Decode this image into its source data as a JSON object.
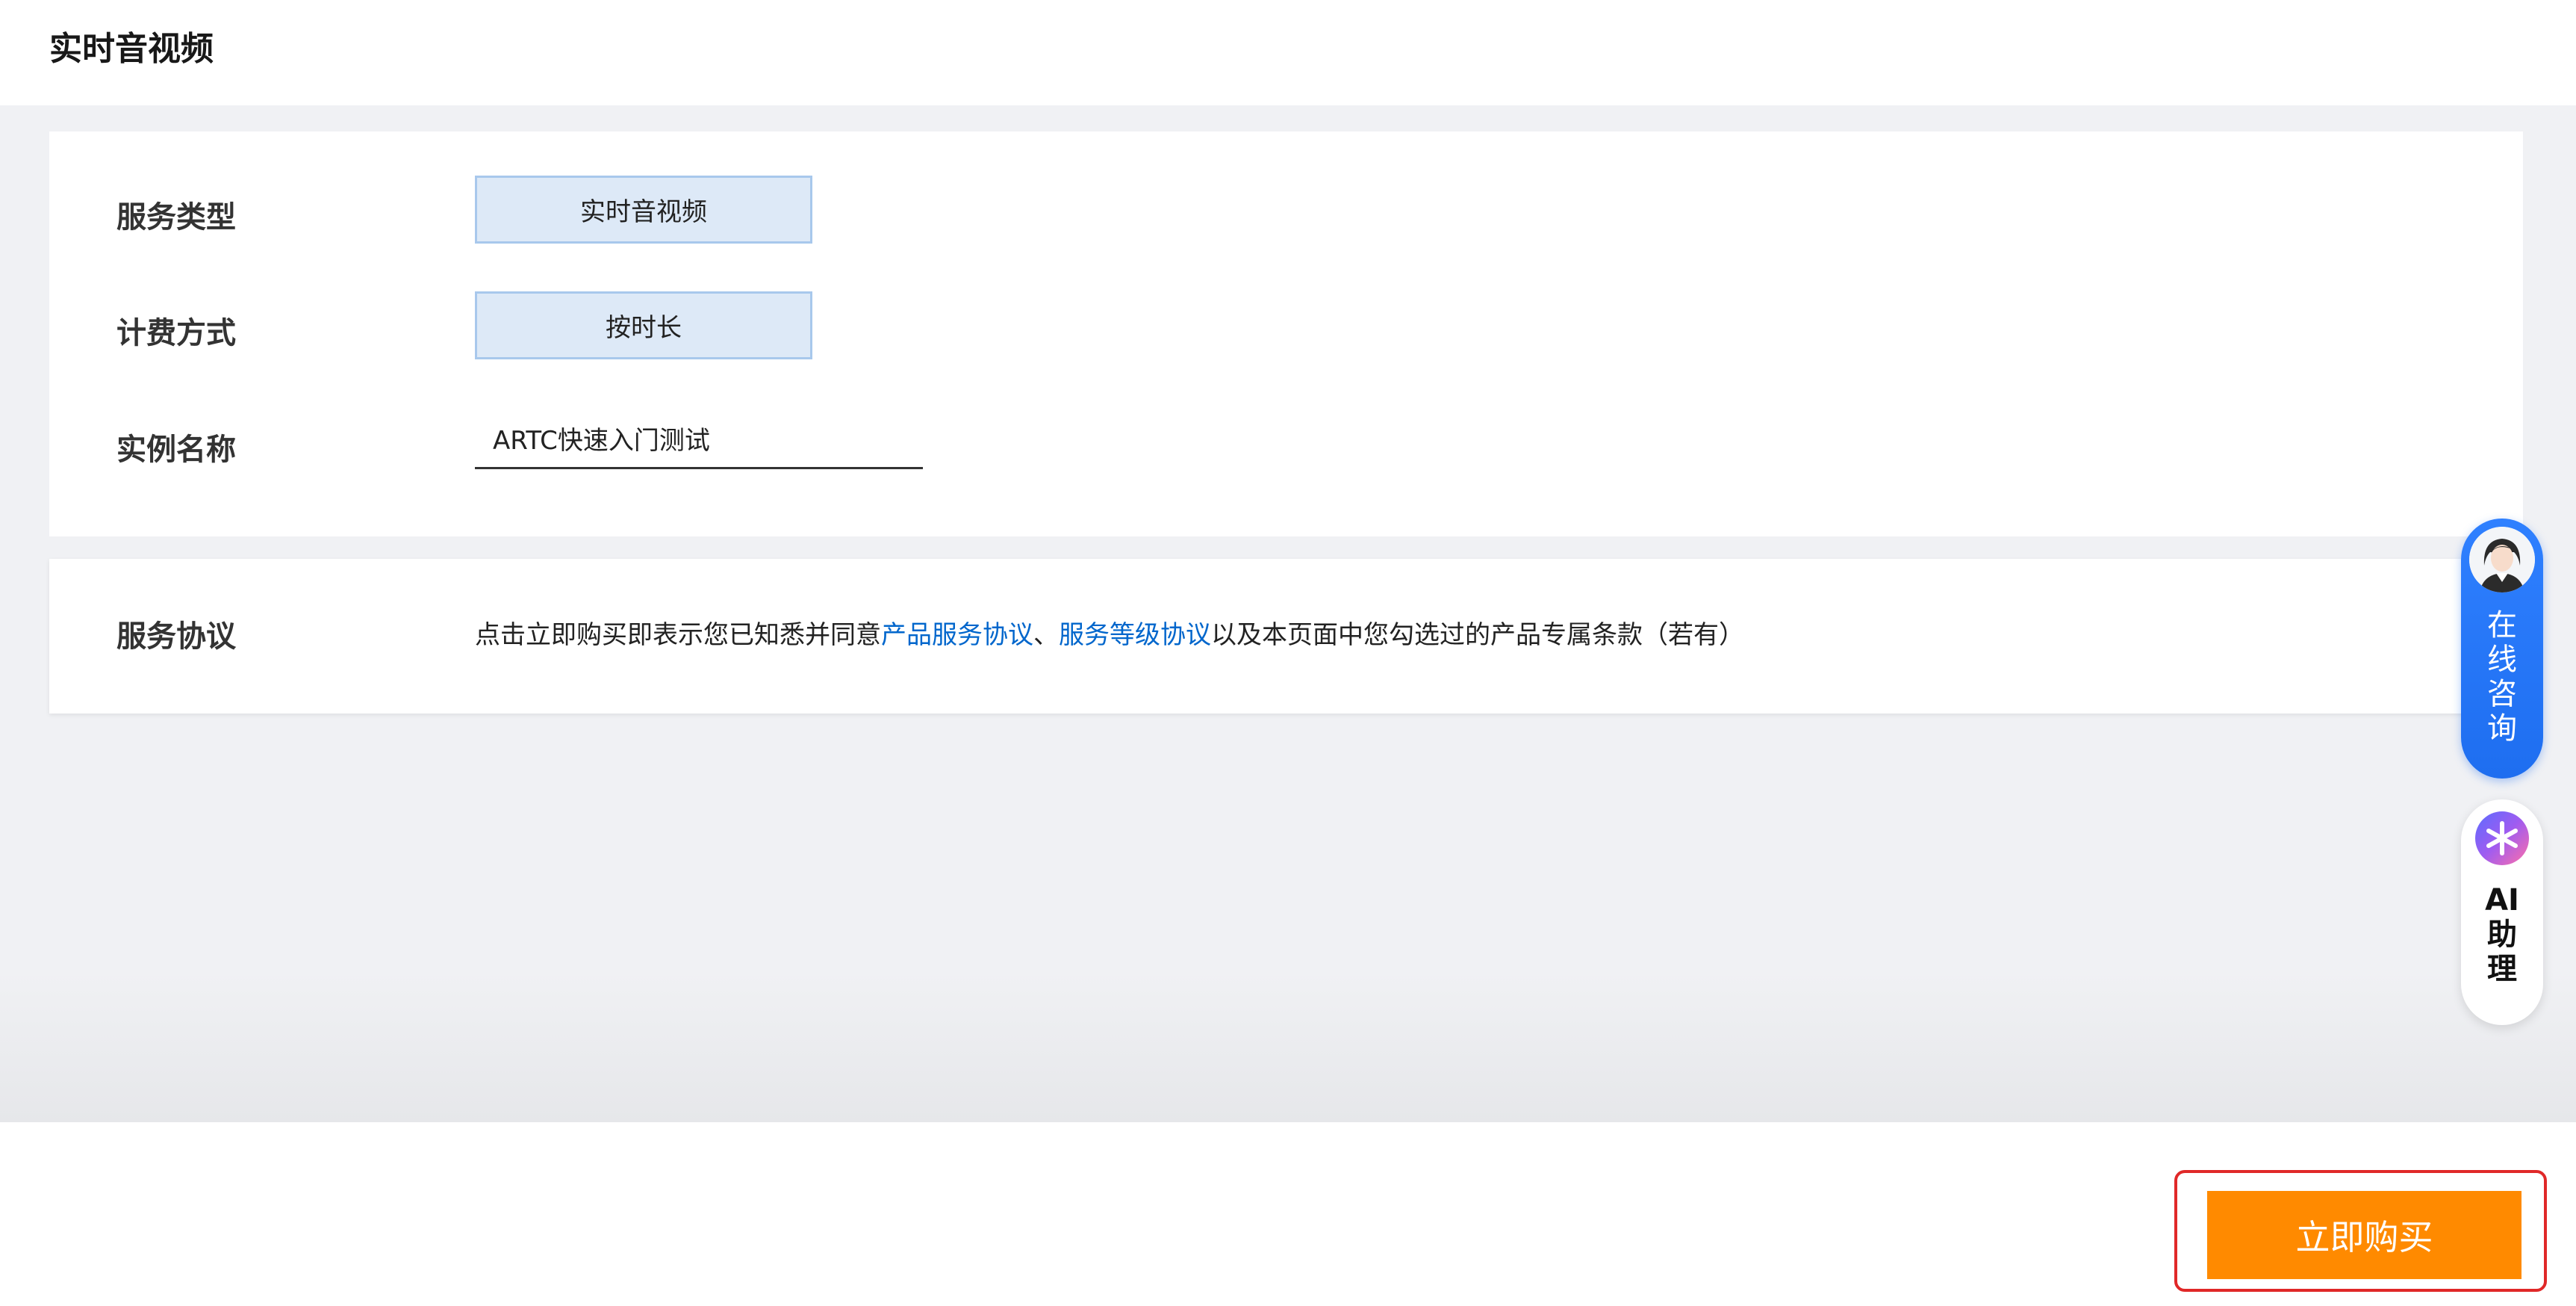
{
  "header": {
    "title": "实时音视频"
  },
  "config": {
    "service_type": {
      "label": "服务类型",
      "value": "实时音视频"
    },
    "billing": {
      "label": "计费方式",
      "value": "按时长"
    },
    "instance_name": {
      "label": "实例名称",
      "value": "ARTC快速入门测试"
    }
  },
  "agreement": {
    "label": "服务协议",
    "text_before": "点击立即购买即表示您已知悉并同意",
    "link1": "产品服务协议",
    "separator": "、",
    "link2": "服务等级协议",
    "text_after": "以及本页面中您勾选过的产品专属条款（若有）"
  },
  "footer": {
    "buy_label": "立即购买"
  },
  "floating": {
    "consult_line1": "在",
    "consult_line2": "线",
    "consult_line3": "咨",
    "consult_line4": "询",
    "ai_line1": "AI",
    "ai_line2": "助",
    "ai_line3": "理",
    "consult_icon": "avatar-icon",
    "ai_icon": "ai-assistant-icon"
  },
  "colors": {
    "accent_orange": "#ff8a00",
    "link_blue": "#0066cc",
    "option_bg": "#dde9f7",
    "consult_blue": "#2f80ff",
    "highlight_red": "#e02828"
  }
}
